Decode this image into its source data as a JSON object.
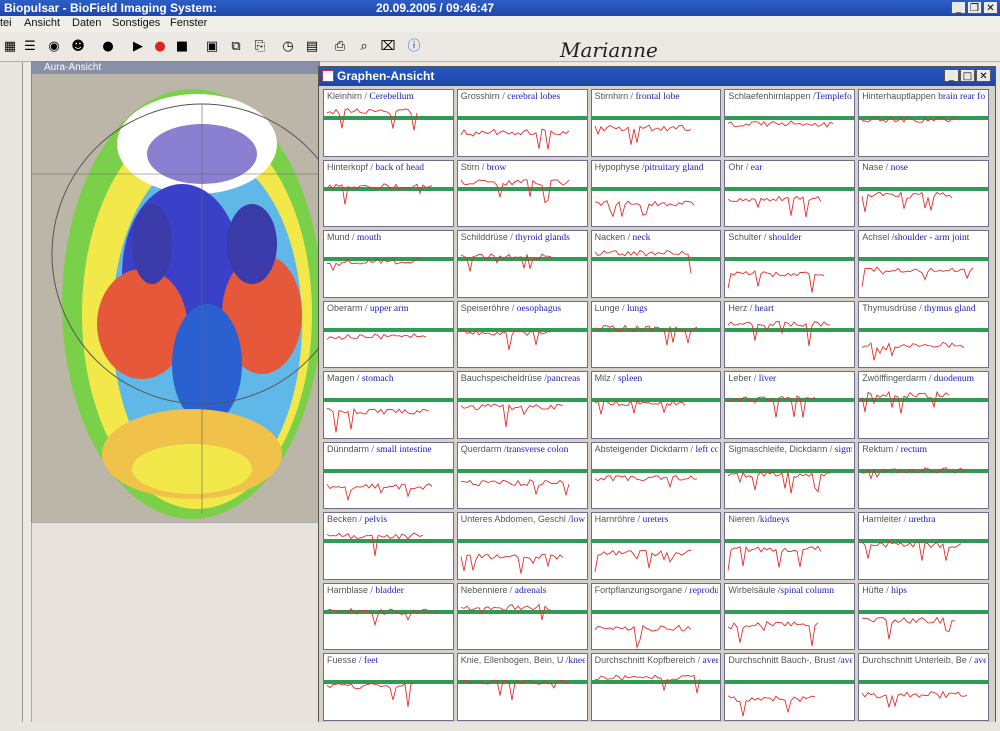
{
  "app": {
    "title": "Biopulsar - BioField Imaging System:",
    "datetime": "20.09.2005 / 09:46:47",
    "signature": "Marianne"
  },
  "menu": [
    "tei",
    "Ansicht",
    "Daten",
    "Sonstiges",
    "Fenster"
  ],
  "aura_window": {
    "title": "Aura-Ansicht"
  },
  "graph_window": {
    "title": "Graphen-Ansicht"
  },
  "organs": [
    {
      "de": "Kleinhirn",
      "en": "/ Cerebellum"
    },
    {
      "de": "Grosshirn",
      "en": "/ cerebral lobes"
    },
    {
      "de": "Stirnhirn",
      "en": "/ frontal lobe"
    },
    {
      "de": "Schlaefenhirnlappen",
      "en": "/Templefolds"
    },
    {
      "de": "Hinterhauptlappen",
      "en": "brain rear folds"
    },
    {
      "de": "Hinterkopf",
      "en": "/ back of head"
    },
    {
      "de": "Stirn",
      "en": "/ brow"
    },
    {
      "de": "Hypophyse",
      "en": "/pitruitary gland"
    },
    {
      "de": "Ohr",
      "en": "/ ear"
    },
    {
      "de": "Nase",
      "en": "/ nose"
    },
    {
      "de": "Mund",
      "en": "/ mouth"
    },
    {
      "de": "Schilddrüse",
      "en": "/ thyroid glands"
    },
    {
      "de": "Nacken",
      "en": "/ neck"
    },
    {
      "de": "Schulter",
      "en": "/ shoulder"
    },
    {
      "de": "Achsel",
      "en": "/shoulder - arm joint"
    },
    {
      "de": "Oberarm",
      "en": "/ upper arm"
    },
    {
      "de": "Speiseröhre",
      "en": "/ oesophagus"
    },
    {
      "de": "Lunge",
      "en": "/ lungs"
    },
    {
      "de": "Herz",
      "en": "/ heart"
    },
    {
      "de": "Thymusdrüse",
      "en": "/ thymus gland"
    },
    {
      "de": "Magen",
      "en": "/ stomach"
    },
    {
      "de": "Bauchspeicheldrüse",
      "en": "/pancreas"
    },
    {
      "de": "Milz",
      "en": "/ spleen"
    },
    {
      "de": "Leber",
      "en": "/ liver"
    },
    {
      "de": "Zwölffingerdarm",
      "en": "/ duodenum"
    },
    {
      "de": "Dünndarm",
      "en": "/ small intestine"
    },
    {
      "de": "Querdarm",
      "en": "/transverse colon"
    },
    {
      "de": "Absteigender Dickdarm",
      "en": "/ left colon"
    },
    {
      "de": "Sigmaschleife, Dickdarm",
      "en": "/ sigmoid colon"
    },
    {
      "de": "Rektum",
      "en": "/ rectum"
    },
    {
      "de": "Becken",
      "en": "/ pelvis"
    },
    {
      "de": "Unteres Abdomen, Geschl",
      "en": "/lower abdomen & sex. organs"
    },
    {
      "de": "Harnröhre",
      "en": "/ ureters"
    },
    {
      "de": "Nieren",
      "en": "/kidneys"
    },
    {
      "de": "Harnleiter",
      "en": "/ urethra"
    },
    {
      "de": "Harnblase",
      "en": "/ bladder"
    },
    {
      "de": "Nebenniere",
      "en": "/ adrenals"
    },
    {
      "de": "Fortpflanzungsorgane",
      "en": "/ reproductive organs"
    },
    {
      "de": "Wirbelsäule",
      "en": "/spinal column"
    },
    {
      "de": "Hüfte",
      "en": "/ hips"
    },
    {
      "de": "Fuesse",
      "en": "/ feet"
    },
    {
      "de": "Knie, Ellenbogen, Bein, U",
      "en": "/knees, elbows, leg U........."
    },
    {
      "de": "Durchschnitt Kopfbereich",
      "en": "/ average, head area"
    },
    {
      "de": "Durchschnitt Bauch-, Brust",
      "en": "/average, abdomen & chest"
    },
    {
      "de": "Durchschnitt Unterleib, Be",
      "en": "/ average pelvic area"
    }
  ],
  "colors": {
    "trace": "#e0302c",
    "band": "#2f9b54",
    "label": "#1b1bb0",
    "title": "#1e46a8"
  }
}
